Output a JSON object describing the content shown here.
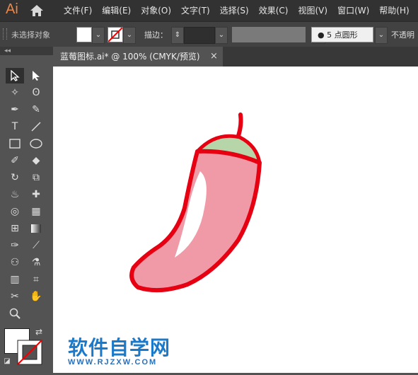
{
  "app": {
    "logo": "Ai"
  },
  "menu": {
    "items": [
      "文件(F)",
      "编辑(E)",
      "对象(O)",
      "文字(T)",
      "选择(S)",
      "效果(C)",
      "视图(V)",
      "窗口(W)",
      "帮助(H)"
    ]
  },
  "control_bar": {
    "selection_status": "未选择对象",
    "stroke_label": "描边：",
    "brush_label": "5 点圆形",
    "opacity_label": "不透明"
  },
  "document": {
    "tab_title": "蓝莓图标.ai* @ 100% (CMYK/预览)",
    "close_glyph": "×"
  },
  "toolbar": {
    "collapse_glyph": "◂◂",
    "type_tool_glyph": "T"
  },
  "watermark": {
    "title": "软件自学网",
    "url": "WWW.RJZXW.COM"
  },
  "colors": {
    "pepper_fill": "#f19aa7",
    "pepper_stroke": "#e60012",
    "stem_fill": "#b6d5a8",
    "menubar": "#323232",
    "panel": "#535353"
  }
}
